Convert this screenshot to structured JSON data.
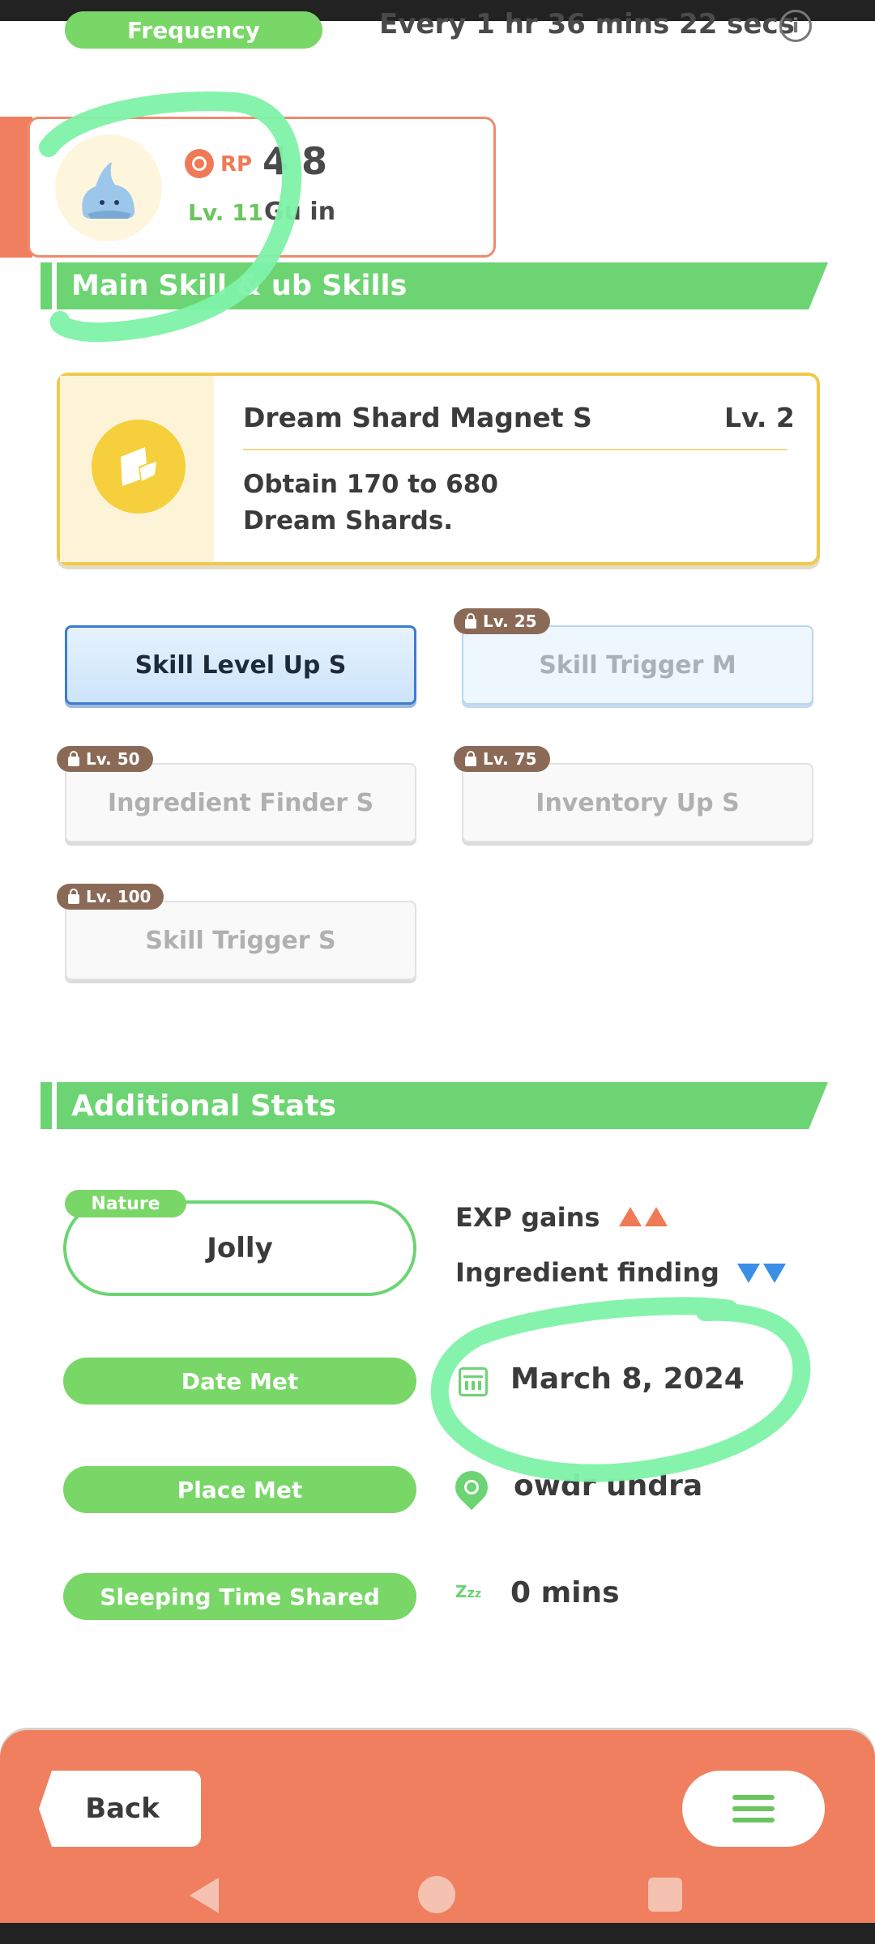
{
  "frequency": {
    "label": "Frequency",
    "value": "Every 1 hr 36 mins 22 secs",
    "info_icon": "info-icon"
  },
  "pokemon": {
    "rp_label": "RP",
    "rp_value": "4 8",
    "level": "Lv. 11",
    "name": "Gu in"
  },
  "skills_section": {
    "title": "Main Skill & ub Skills"
  },
  "main_skill": {
    "name": "Dream Shard Magnet S",
    "level": "Lv. 2",
    "description_line1": "Obtain 170 to 680",
    "description_line2": "Dream Shards."
  },
  "sub_skills": [
    {
      "label": "Skill Level Up S",
      "unlock": ""
    },
    {
      "label": "Skill Trigger M",
      "unlock": "Lv. 25"
    },
    {
      "label": "Ingredient Finder S",
      "unlock": "Lv. 50"
    },
    {
      "label": "Inventory Up S",
      "unlock": "Lv. 75"
    },
    {
      "label": "Skill Trigger S",
      "unlock": "Lv. 100"
    }
  ],
  "additional_stats": {
    "title": "Additional Stats",
    "nature_tag": "Nature",
    "nature_value": "Jolly",
    "nature_up": "EXP gains",
    "nature_down": "Ingredient finding",
    "date_met_label": "Date Met",
    "date_met_value": "March 8, 2024",
    "place_met_label": "Place Met",
    "place_met_value": "owdr   undra",
    "sleep_label": "Sleeping Time Shared",
    "sleep_value": "0 mins",
    "zzz_icon": "Z"
  },
  "footer": {
    "back_label": "Back"
  },
  "colors": {
    "green": "#6cd472",
    "orange": "#ef7f5f",
    "annotation": "#7ef2a8"
  }
}
